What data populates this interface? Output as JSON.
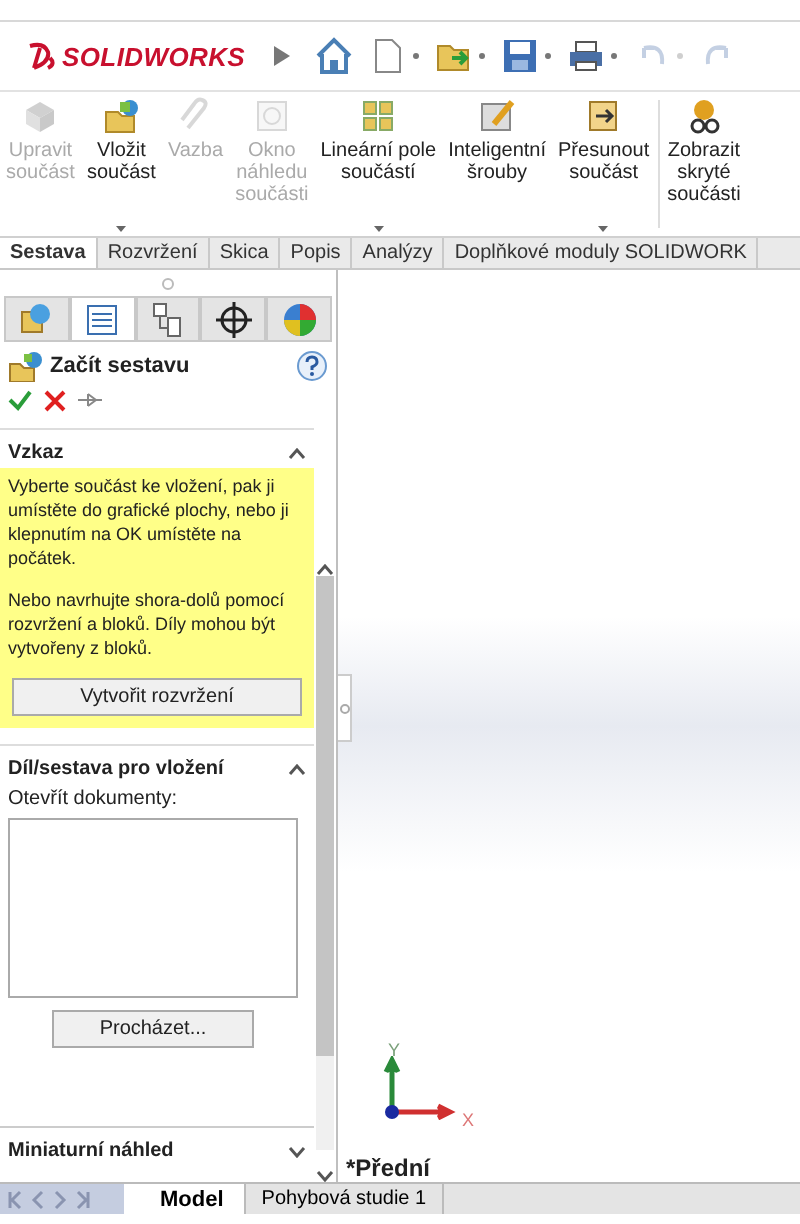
{
  "app": {
    "logo": "SOLIDWORKS"
  },
  "quick_access": [
    {
      "kind": "home",
      "disabled": false,
      "dropdown": false
    },
    {
      "kind": "new",
      "disabled": false,
      "dropdown": true
    },
    {
      "kind": "open",
      "disabled": false,
      "dropdown": true
    },
    {
      "kind": "save",
      "disabled": false,
      "dropdown": true
    },
    {
      "kind": "print",
      "disabled": false,
      "dropdown": true
    },
    {
      "kind": "undo",
      "disabled": true,
      "dropdown": true
    },
    {
      "kind": "redo",
      "disabled": true,
      "dropdown": false
    }
  ],
  "ribbon": [
    {
      "kind": "edit",
      "label": "Upravit\nsoučást",
      "disabled": true,
      "dropdown": false
    },
    {
      "kind": "insert",
      "label": "Vložit\nsoučást",
      "disabled": false,
      "dropdown": true
    },
    {
      "kind": "mate",
      "label": "Vazba",
      "disabled": true,
      "dropdown": false
    },
    {
      "kind": "preview",
      "label": "Okno\nnáhledu\nsoučásti",
      "disabled": true,
      "dropdown": false
    },
    {
      "kind": "pattern",
      "label": "Lineární pole\nsoučástí",
      "disabled": false,
      "dropdown": true
    },
    {
      "kind": "bolts",
      "label": "Inteligentní\nšrouby",
      "disabled": false,
      "dropdown": false
    },
    {
      "kind": "move",
      "label": "Přesunout\nsoučást",
      "disabled": false,
      "dropdown": true
    },
    {
      "kind": "show",
      "label": "Zobrazit\nskryté\nsoučásti",
      "disabled": false,
      "dropdown": false
    }
  ],
  "tabs": [
    {
      "label": "Sestava",
      "selected": true
    },
    {
      "label": "Rozvržení",
      "selected": false
    },
    {
      "label": "Skica",
      "selected": false
    },
    {
      "label": "Popis",
      "selected": false
    },
    {
      "label": "Analýzy",
      "selected": false
    },
    {
      "label": "Doplňkové moduly SOLIDWORK",
      "selected": false
    }
  ],
  "panel_tabs": [
    {
      "kind": "feature-tree",
      "selected": false
    },
    {
      "kind": "property",
      "selected": true
    },
    {
      "kind": "configuration",
      "selected": false
    },
    {
      "kind": "dimxpert",
      "selected": false
    },
    {
      "kind": "appearance",
      "selected": false
    }
  ],
  "property_manager": {
    "title": "Začít sestavu"
  },
  "sections": [
    {
      "kind": "message",
      "title": "Vzkaz",
      "expanded": true,
      "paragraphs": [
        "Vyberte součást ke vložení, pak ji umístěte do grafické plochy, nebo ji klepnutím na OK umístěte na počátek.",
        "Nebo navrhujte shora-dolů pomocí rozvržení a bloků. Díly mohou být vytvořeny z bloků."
      ],
      "button": "Vytvořit rozvržení"
    },
    {
      "kind": "documents",
      "title": "Díl/sestava pro vložení",
      "expanded": true,
      "label": "Otevřít dokumenty:",
      "button": "Procházet..."
    },
    {
      "kind": "thumbnail",
      "title": "Miniaturní náhled",
      "expanded": false
    }
  ],
  "viewport": {
    "view_name": "*Přední",
    "axis_y": "Y",
    "axis_x": "X"
  },
  "bottom_tabs": [
    {
      "label": "Model",
      "selected": true
    },
    {
      "label": "Pohybová studie 1",
      "selected": false
    }
  ]
}
